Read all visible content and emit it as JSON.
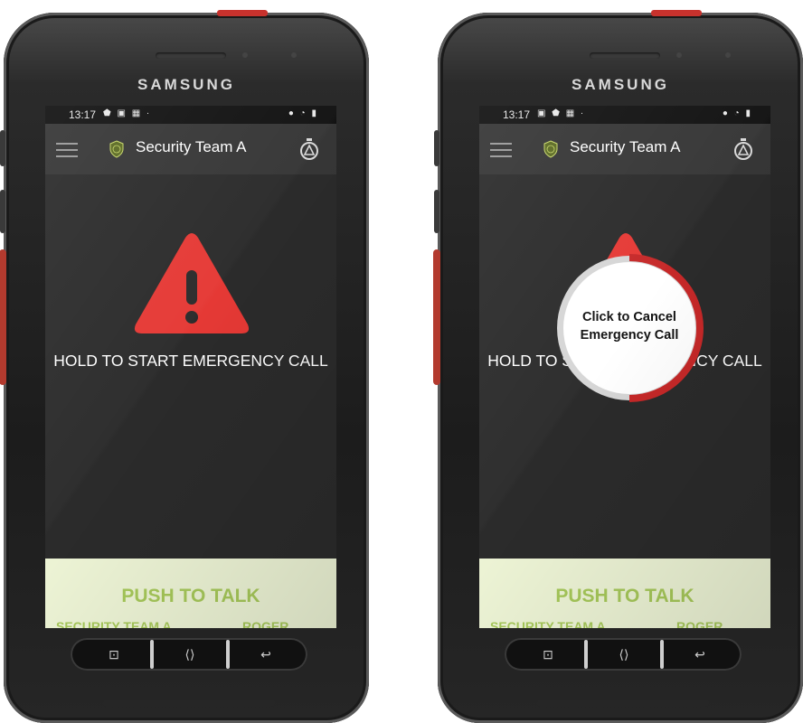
{
  "brand": "SAMSUNG",
  "colors": {
    "accent_red": "#e53935",
    "ptt_background": "#eef5d6",
    "ptt_text": "#a7c95a",
    "app_bar": "#363636",
    "screen_background": "#2b2b2b"
  },
  "screens": [
    {
      "status_bar": {
        "time": "13:17"
      },
      "app_bar": {
        "menu_icon": "hamburger-menu-icon",
        "badge_icon": "lwp-shield-icon",
        "team_name": "Security Team A",
        "alarm_icon": "emergency-alarm-icon"
      },
      "emergency": {
        "icon": "warning-triangle-icon",
        "label": "HOLD TO START EMERGENCY CALL"
      },
      "ptt": {
        "label": "PUSH TO TALK",
        "channel": "SECURITY TEAM A",
        "status": "ROGER"
      },
      "nav": {
        "recents": "⊡",
        "home": "⟨⟩",
        "back": "↩"
      }
    },
    {
      "status_bar": {
        "time": "13:17"
      },
      "app_bar": {
        "menu_icon": "hamburger-menu-icon",
        "badge_icon": "lwp-shield-icon",
        "team_name": "Security Team A",
        "alarm_icon": "emergency-alarm-icon"
      },
      "emergency": {
        "icon": "warning-triangle-icon",
        "label": "HOLD TO START EMERGENCY CALL"
      },
      "cancel_dialog": {
        "line1": "Click to Cancel",
        "line2": "Emergency Call",
        "progress": 0.5
      },
      "ptt": {
        "label": "PUSH TO TALK",
        "channel": "SECURITY TEAM A",
        "status": "ROGER"
      },
      "nav": {
        "recents": "⊡",
        "home": "⟨⟩",
        "back": "↩"
      }
    }
  ]
}
